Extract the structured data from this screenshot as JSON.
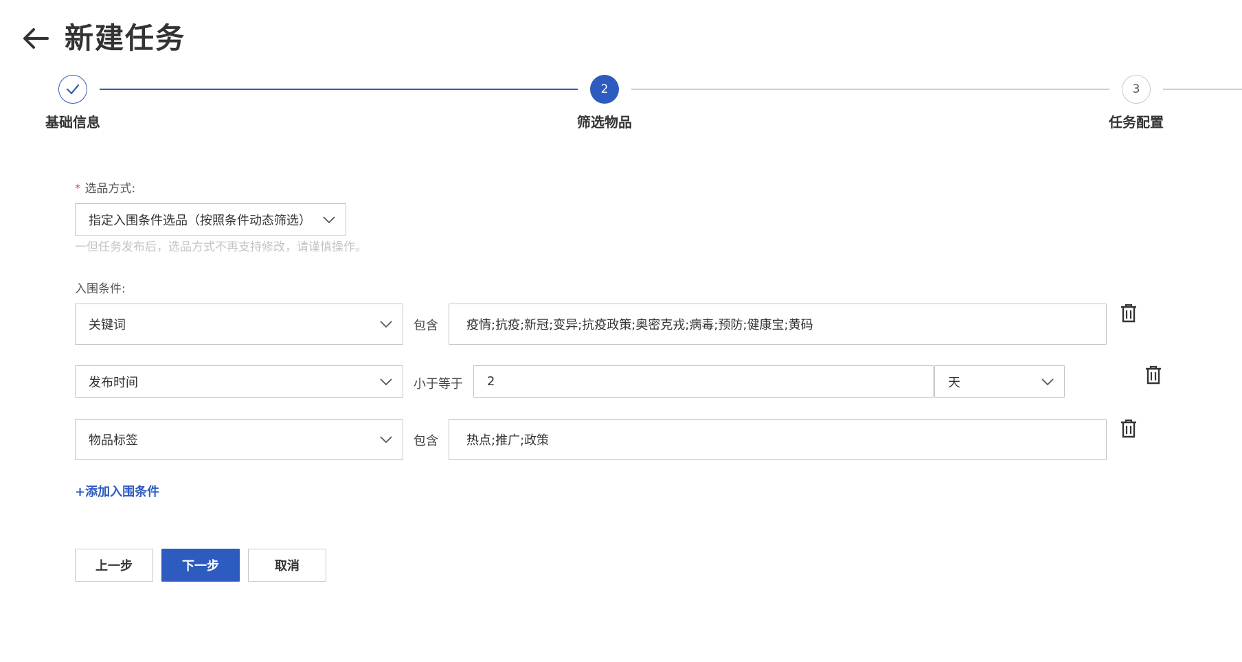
{
  "header": {
    "title": "新建任务",
    "back_icon": "arrow-left-icon"
  },
  "colors": {
    "primary": "#2d5bbf",
    "required": "#e03c3c",
    "hint": "#c4c4c4"
  },
  "steps": [
    {
      "label": "基础信息",
      "number": "",
      "status": "done",
      "icon": "check-icon"
    },
    {
      "label": "筛选物品",
      "number": "2",
      "status": "active"
    },
    {
      "label": "任务配置",
      "number": "3",
      "status": "wait"
    }
  ],
  "selection": {
    "label": "选品方式:",
    "required_mark": "*",
    "value": "指定入围条件选品（按照条件动态筛选）",
    "hint": "一但任务发布后，选品方式不再支持修改，请谨慎操作。"
  },
  "conditions": {
    "label": "入围条件:",
    "rows": [
      {
        "field": "关键词",
        "operator": "包含",
        "value": "疫情;抗疫;新冠;变异;抗疫政策;奥密克戎;病毒;预防;健康宝;黄码"
      },
      {
        "field": "发布时间",
        "operator": "小于等于",
        "value": "2",
        "unit": "天"
      },
      {
        "field": "物品标签",
        "operator": "包含",
        "value": "热点;推广;政策"
      }
    ],
    "add_label": "+添加入围条件"
  },
  "buttons": {
    "prev": "上一步",
    "next": "下一步",
    "cancel": "取消"
  }
}
